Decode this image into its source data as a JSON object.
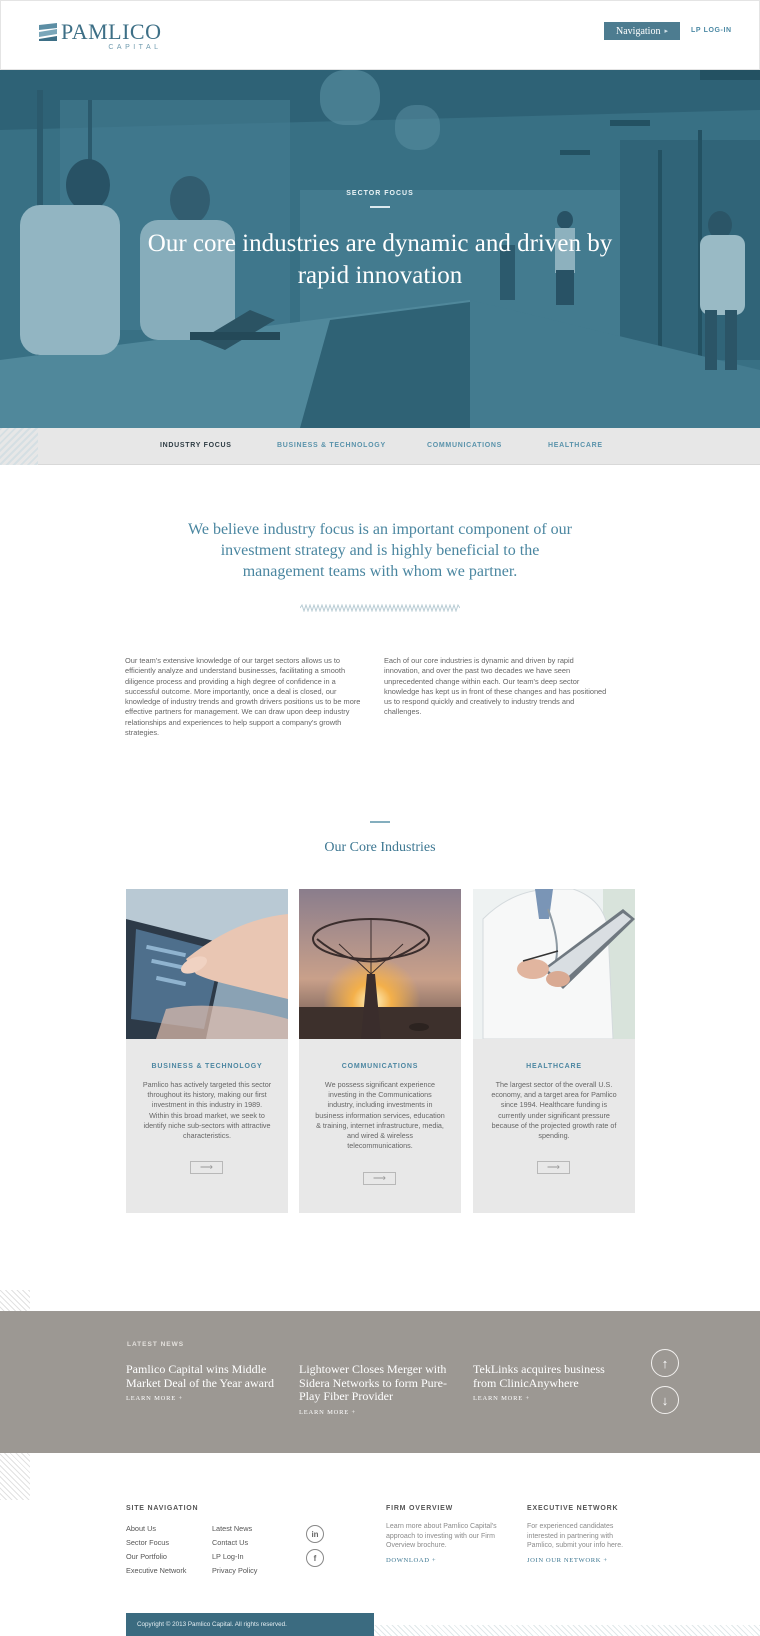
{
  "header": {
    "logo_name": "PAMLICO",
    "logo_sub": "CAPITAL",
    "nav_button": "Navigation",
    "nav_caret": "▸",
    "lp_login": "LP LOG-IN"
  },
  "hero": {
    "eyebrow": "SECTOR FOCUS",
    "title": "Our core industries are dynamic and driven by rapid innovation"
  },
  "subnav": {
    "items": [
      "INDUSTRY FOCUS",
      "BUSINESS & TECHNOLOGY",
      "COMMUNICATIONS",
      "HEALTHCARE"
    ],
    "active_index": 0
  },
  "intro": {
    "quote": "We believe industry focus is an important component of our investment strategy and is highly beneficial to the management teams with whom we partner.",
    "left_paragraph": "Our team's extensive knowledge of our target sectors allows us to efficiently analyze and understand businesses, facilitating a smooth diligence process and providing a high degree of confidence in a successful outcome. More importantly, once a deal is closed, our knowledge of industry trends and growth drivers positions us to be more effective partners for management. We can draw upon deep industry relationships and experiences to help support a company's growth strategies.",
    "right_paragraph": "Each of our core industries is dynamic and driven by rapid innovation, and over the past two decades we have seen unprecedented change within each. Our team's deep sector knowledge has kept us in front of these changes and has positioned us to respond quickly and creatively to industry trends and challenges."
  },
  "core": {
    "title": "Our Core Industries",
    "cards": [
      {
        "title": "BUSINESS & TECHNOLOGY",
        "body": "Pamlico has actively targeted this sector throughout its history, making our first investment in this industry in 1989. Within this broad market, we seek to identify niche sub-sectors with attractive characteristics.",
        "arrow": "⟶"
      },
      {
        "title": "COMMUNICATIONS",
        "body": "We possess significant experience investing in the Communications industry, including investments in business information services, education & training, internet infrastructure, media, and wired & wireless telecommunications.",
        "arrow": "⟶"
      },
      {
        "title": "HEALTHCARE",
        "body": "The largest sector of the overall U.S. economy, and a target area for Pamlico since 1994. Healthcare funding is currently under significant pressure because of the projected growth rate of spending.",
        "arrow": "⟶"
      }
    ]
  },
  "news": {
    "eyebrow": "LATEST NEWS",
    "items": [
      {
        "headline": "Pamlico Capital wins Middle Market Deal of the Year award",
        "more": "LEARN MORE +"
      },
      {
        "headline": "Lightower Closes Merger with Sidera Networks to form Pure-Play Fiber Provider",
        "more": "LEARN MORE +"
      },
      {
        "headline": "TekLinks acquires business from ClinicAnywhere",
        "more": "LEARN MORE +"
      }
    ],
    "up_arrow": "↑",
    "down_arrow": "↓"
  },
  "footer": {
    "site_nav_heading": "SITE NAVIGATION",
    "nav_col1": [
      "About Us",
      "Sector Focus",
      "Our Portfolio",
      "Executive Network"
    ],
    "nav_col2": [
      "Latest News",
      "Contact Us",
      "LP Log-In",
      "Privacy Policy"
    ],
    "social": [
      "in",
      "f"
    ],
    "firm_heading": "FIRM OVERVIEW",
    "firm_desc": "Learn more about Pamlico Capital's approach to investing with our Firm Overview brochure.",
    "firm_cta": "DOWNLOAD +",
    "exec_heading": "EXECUTIVE NETWORK",
    "exec_desc": "For experienced candidates interested in partnering with Pamlico, submit your info here.",
    "exec_cta": "JOIN OUR NETWORK +",
    "copyright": "Copyright © 2013 Pamlico Capital. All rights reserved."
  },
  "colors": {
    "brand": "#3d6f86",
    "hero_tint": "#3c7185",
    "news_bg": "#9c9893",
    "card_bg": "#e8e8e8"
  }
}
